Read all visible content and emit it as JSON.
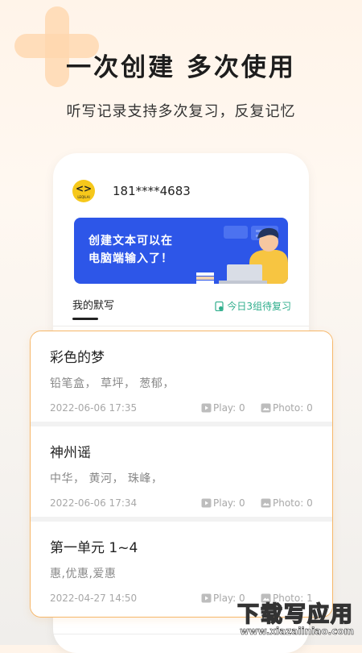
{
  "headline": "一次创建  多次使用",
  "subline": "听写记录支持多次复习，反复记忆",
  "profile": {
    "phone": "181****4683",
    "logo_glyph": "<>",
    "logo_text": "LEQILAI"
  },
  "banner": {
    "line1": "创建文本可以在",
    "line2": "电脑端输入了！"
  },
  "tabs": {
    "my_dictation": "我的默写",
    "review_today": "今日3组待复习"
  },
  "entries": [
    {
      "title": "彩色的梦",
      "words": "铅笔盒， 草坪， 葱郁，",
      "date": "2022-06-06 17:35",
      "play": "Play: 0",
      "photo": "Photo: 0"
    },
    {
      "title": "神州谣",
      "words": "中华， 黄河， 珠峰，",
      "date": "2022-06-06 17:34",
      "play": "Play: 0",
      "photo": "Photo: 0"
    },
    {
      "title": "第一单元 1~4",
      "words": "惠,优惠,爱惠",
      "date": "2022-04-27 14:50",
      "play": "Play: 0",
      "photo": "Photo: 1"
    }
  ],
  "watermark": {
    "big": "下载写应用",
    "small": "www.xiazaiiniao.com"
  },
  "colors": {
    "accent_orange": "#f6b76a",
    "review_green": "#2fae8c",
    "banner_blue": "#2d56e8",
    "logo_yellow": "#f6c81b"
  }
}
